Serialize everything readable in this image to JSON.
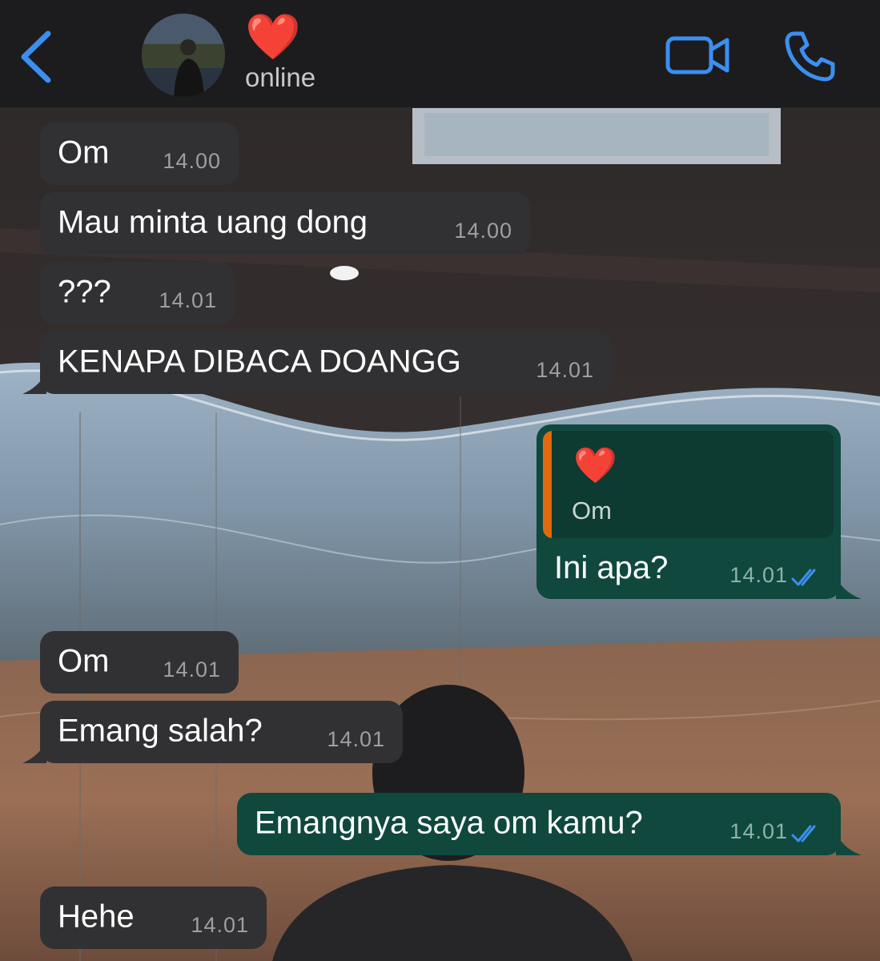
{
  "header": {
    "back_label": "Back",
    "contact_name": "❤️",
    "status": "online"
  },
  "messages": [
    {
      "direction": "incoming",
      "text": "Om",
      "time": "14.00"
    },
    {
      "direction": "incoming",
      "text": "Mau minta uang dong",
      "time": "14.00"
    },
    {
      "direction": "incoming",
      "text": "???",
      "time": "14.01"
    },
    {
      "direction": "incoming",
      "text": "KENAPA DIBACA DOANGG",
      "time": "14.01"
    },
    {
      "direction": "outgoing",
      "text": "Ini apa?",
      "time": "14.01",
      "read": true,
      "quote": {
        "sender": "❤️",
        "text": "Om"
      }
    },
    {
      "direction": "incoming",
      "text": "Om",
      "time": "14.01"
    },
    {
      "direction": "incoming",
      "text": "Emang salah?",
      "time": "14.01"
    },
    {
      "direction": "outgoing",
      "text": "Emangnya saya om kamu?",
      "time": "14.01",
      "read": true
    },
    {
      "direction": "incoming",
      "text": "Hehe",
      "time": "14.01"
    }
  ],
  "colors": {
    "accent": "#3b8ff0",
    "incoming_bubble": "#313133",
    "outgoing_bubble": "#10483e",
    "quote_bar": "#e3680d",
    "read_ticks": "#3b8ff0"
  },
  "icons": {
    "back": "chevron-left-icon",
    "video": "video-camera-icon",
    "call": "phone-icon",
    "read": "double-check-icon"
  }
}
